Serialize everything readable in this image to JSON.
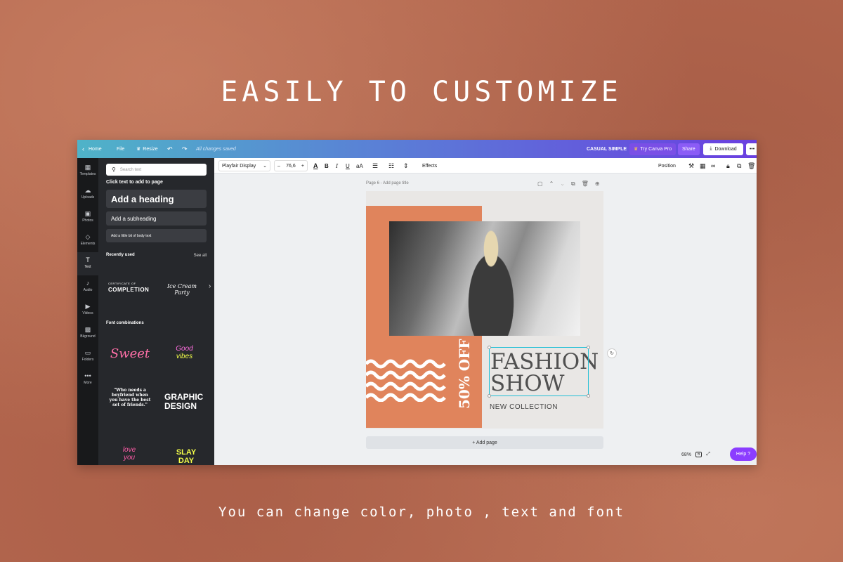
{
  "headline": "EASILY TO CUSTOMIZE",
  "footer_text": "You can change color, photo , text and font",
  "topbar": {
    "home": "Home",
    "file": "File",
    "resize": "Resize",
    "saved_status": "All changes saved",
    "design_name": "CASUAL SIMPLE",
    "try_pro": "Try Canva Pro",
    "share": "Share",
    "download": "Download",
    "more": "•••"
  },
  "toolbar": {
    "font": "Playfair Display",
    "font_size": "76,6",
    "minus": "–",
    "plus": "+",
    "bold": "B",
    "italic": "I",
    "case": "aA",
    "effects": "Effects",
    "position": "Position"
  },
  "rail": [
    {
      "label": "Templates",
      "icon": "▦"
    },
    {
      "label": "Uploads",
      "icon": "☁"
    },
    {
      "label": "Photos",
      "icon": "▣"
    },
    {
      "label": "Elements",
      "icon": "◇"
    },
    {
      "label": "Text",
      "icon": "T"
    },
    {
      "label": "Audio",
      "icon": "♪"
    },
    {
      "label": "Videos",
      "icon": "▶"
    },
    {
      "label": "Bkground",
      "icon": "▩"
    },
    {
      "label": "Folders",
      "icon": "▭"
    },
    {
      "label": "More",
      "icon": "•••"
    }
  ],
  "panel": {
    "search_placeholder": "Search text",
    "click_text": "Click text to add to page",
    "add_heading": "Add a heading",
    "add_subheading": "Add a subheading",
    "add_body": "Add a little bit of body text",
    "recently_used": "Recently used",
    "see_all": "See all",
    "recent_1_small": "CERTIFICATE OF",
    "recent_1_big": "COMPLETION",
    "recent_2": "Ice Cream Party",
    "font_combinations": "Font combinations",
    "combo_sweet": "Sweet",
    "combo_good": "Good",
    "combo_vibes": "vibes",
    "combo_quote": "\"Who needs a boyfriend when you have the best set of friends.\"",
    "combo_graphic": "GRAPHIC",
    "combo_design": "DESIGN",
    "combo_love": "love",
    "combo_you": "you",
    "combo_slay": "SLAY",
    "combo_day": "DAY"
  },
  "canvas": {
    "page_label": "Page 6 - Add page title",
    "fashion": "FASHION",
    "show": "SHOW",
    "off": "50% OFF",
    "new_collection": "NEW COLLECTION",
    "add_page": "+ Add page"
  },
  "footer": {
    "zoom": "68%",
    "page_count": "6",
    "help": "Help ?"
  },
  "colors": {
    "background": "#b5684f",
    "accent_orange": "#e0845c",
    "canva_purple": "#8b3dff"
  }
}
